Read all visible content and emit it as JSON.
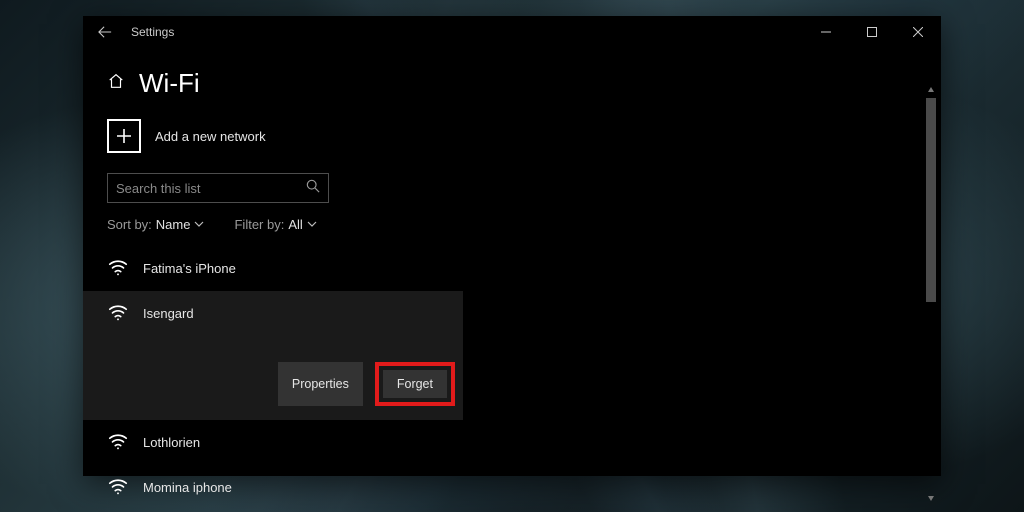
{
  "window": {
    "title": "Settings"
  },
  "page": {
    "title": "Wi-Fi"
  },
  "addNetwork": {
    "label": "Add a new network"
  },
  "search": {
    "placeholder": "Search this list"
  },
  "filters": {
    "sortLabel": "Sort by:",
    "sortValue": "Name",
    "filterLabel": "Filter by:",
    "filterValue": "All"
  },
  "networks": [
    {
      "name": "Fatima's iPhone"
    },
    {
      "name": "Isengard"
    },
    {
      "name": "Lothlorien"
    },
    {
      "name": "Momina iphone"
    }
  ],
  "actions": {
    "properties": "Properties",
    "forget": "Forget"
  }
}
